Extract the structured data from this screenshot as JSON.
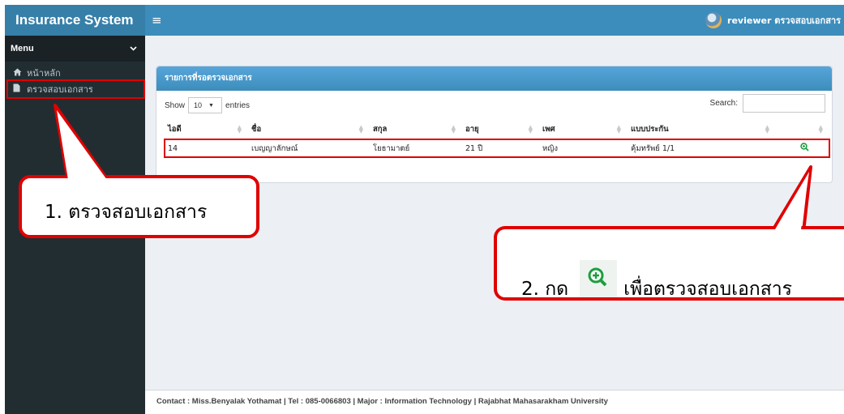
{
  "topbar": {
    "brand": "Insurance System",
    "menu_toggle": "≡",
    "user_label": "reviewer ตรวจสอบเอกสาร"
  },
  "sidebar": {
    "menu_label": "Menu",
    "items": [
      {
        "label": "หน้าหลัก",
        "icon": "home-icon"
      },
      {
        "label": "ตรวจสอบเอกสาร",
        "icon": "file-icon"
      }
    ]
  },
  "panel": {
    "title": "รายการที่รอตรวจเอกสาร",
    "show_label": "Show",
    "entries_value": "10",
    "entries_label": "entries",
    "search_label": "Search:",
    "search_value": "",
    "columns": [
      "ไอดี",
      "ชื่อ",
      "สกุล",
      "อายุ",
      "เพศ",
      "แบบประกัน",
      ""
    ],
    "rows": [
      {
        "id": "14",
        "first_name": "เบญญาลักษณ์",
        "last_name": "โยธามาตย์",
        "age": "21 ปี",
        "gender": "หญิง",
        "plan": "คุ้มทรัพย์ 1/1",
        "action_icon": "zoom-in-icon"
      }
    ]
  },
  "annotations": {
    "step1": "1. ตรวจสอบเอกสาร",
    "step2_prefix": "2. กด",
    "step2_suffix": "เพื่อตรวจสอบเอกสาร",
    "color": "#e00000"
  },
  "footer": {
    "text": "Contact : Miss.Benyalak Yothamat | Tel : 085-0066803 | Major : Information Technology | Rajabhat Mahasarakham University"
  },
  "colors": {
    "topbar": "#3c8dbc",
    "logo_bg": "#367fa9",
    "sidebar": "#222d32",
    "content_bg": "#ecf0f5",
    "zoom_icon": "#1e9e3e"
  }
}
